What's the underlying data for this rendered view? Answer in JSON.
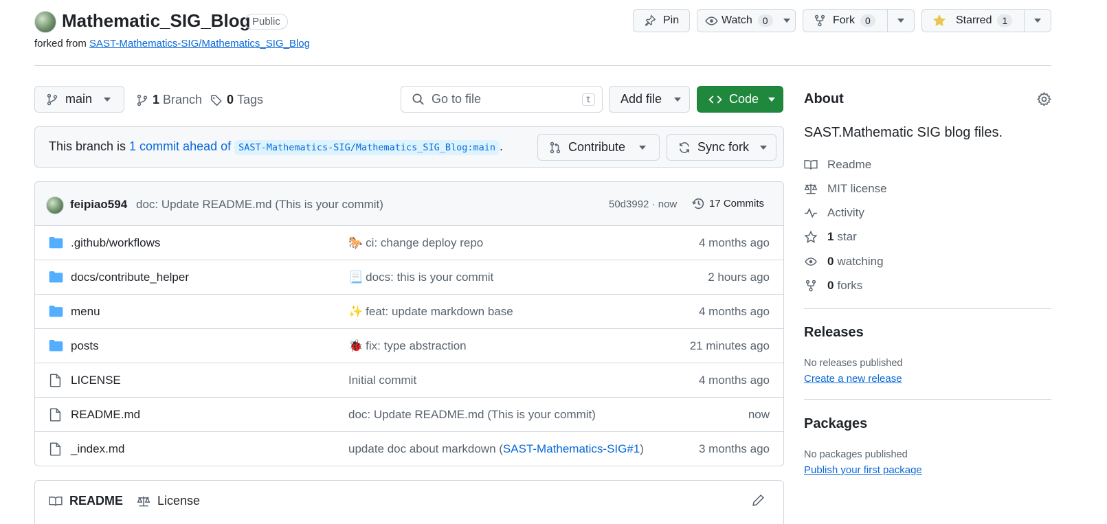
{
  "repo": {
    "name": "Mathematic_SIG_Blog",
    "visibility": "Public",
    "forked_prefix": "forked from ",
    "forked_source": "SAST-Mathematics-SIG/Mathematics_SIG_Blog"
  },
  "actions": {
    "pin": "Pin",
    "watch": "Watch",
    "watch_count": "0",
    "fork": "Fork",
    "fork_count": "0",
    "starred": "Starred",
    "star_count": "1"
  },
  "branch_bar": {
    "branch": "main",
    "branches_count": "1",
    "branches_label": "Branch",
    "tags_count": "0",
    "tags_label": "Tags",
    "search_placeholder": "Go to file",
    "search_shortcut": "t",
    "add_file": "Add file",
    "code": "Code"
  },
  "ahead": {
    "prefix": "This branch is ",
    "link": "1 commit ahead of",
    "target": "SAST-Mathematics-SIG/Mathematics_SIG_Blog:main",
    "suffix": ".",
    "contribute": "Contribute",
    "sync": "Sync fork"
  },
  "latest_commit": {
    "author": "feipiao594",
    "message": "doc: Update README.md (This is your commit)",
    "meta": "50d3992 · now",
    "commits": "17 Commits"
  },
  "files": [
    {
      "name": ".github/workflows",
      "type": "folder",
      "emoji": "🐎",
      "message": "ci: change deploy repo",
      "age": "4 months ago"
    },
    {
      "name": "docs/contribute_helper",
      "type": "folder",
      "emoji": "📃",
      "message": "docs: this is your commit",
      "age": "2 hours ago"
    },
    {
      "name": "menu",
      "type": "folder",
      "emoji": "✨",
      "message": "feat: update markdown base",
      "age": "4 months ago"
    },
    {
      "name": "posts",
      "type": "folder",
      "emoji": "🐞",
      "message": "fix: type abstraction",
      "age": "21 minutes ago"
    },
    {
      "name": "LICENSE",
      "type": "file",
      "emoji": "",
      "message": "Initial commit",
      "age": "4 months ago"
    },
    {
      "name": "README.md",
      "type": "file",
      "emoji": "",
      "message": "doc: Update README.md (This is your commit)",
      "age": "now"
    },
    {
      "name": "_index.md",
      "type": "file",
      "emoji": "",
      "message": "update doc about markdown (",
      "link": "SAST-Mathematics-SIG#1",
      "after": ")",
      "age": "3 months ago"
    }
  ],
  "readme_tabs": {
    "readme": "README",
    "license": "License"
  },
  "about": {
    "title": "About",
    "description": "SAST.Mathematic SIG blog files.",
    "readme": "Readme",
    "license": "MIT license",
    "activity": "Activity",
    "stars_count": "1",
    "stars_label": "star",
    "watching_count": "0",
    "watching_label": "watching",
    "forks_count": "0",
    "forks_label": "forks"
  },
  "releases": {
    "title": "Releases",
    "empty": "No releases published",
    "create": "Create a new release"
  },
  "packages": {
    "title": "Packages",
    "empty": "No packages published",
    "publish": "Publish your first package"
  },
  "colors": {
    "accent_link": "#0969da",
    "code_button": "#1f883d",
    "folder_icon": "#54aeff",
    "star": "#eac54f"
  }
}
